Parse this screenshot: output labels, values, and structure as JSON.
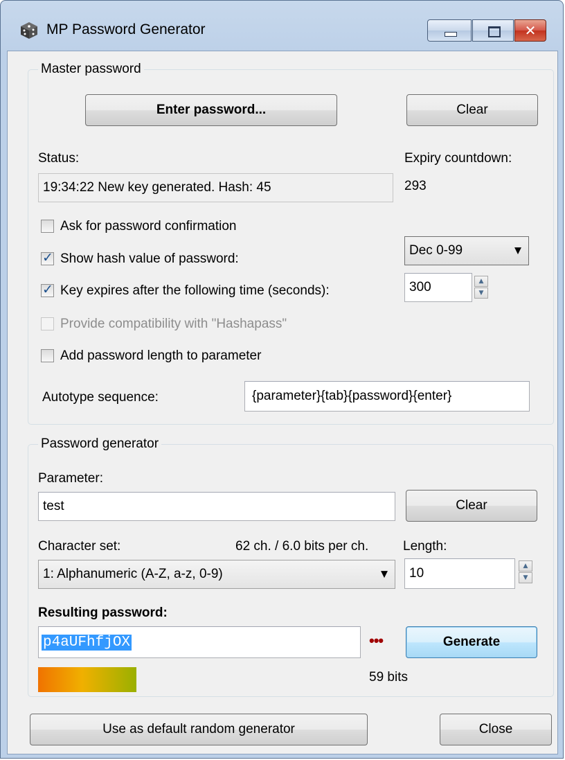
{
  "window": {
    "title": "MP Password Generator",
    "icons": {
      "app": "dice-icon",
      "minimize": "minimize-icon",
      "maximize": "maximize-icon",
      "close": "close-icon"
    },
    "close_glyph": "✕"
  },
  "master": {
    "group_label": "Master password",
    "enter_button": "Enter password...",
    "clear_button": "Clear",
    "status_label": "Status:",
    "status_value": "19:34:22 New key generated. Hash: 45",
    "expiry_label": "Expiry countdown:",
    "expiry_value": "293",
    "ask_confirmation": {
      "label": "Ask for password confirmation",
      "checked": false
    },
    "show_hash": {
      "label": "Show hash value of password:",
      "checked": true
    },
    "hash_format": "Dec 0-99",
    "key_expires": {
      "label": "Key expires after the following time (seconds):",
      "checked": true
    },
    "expiry_seconds": "300",
    "hashapass": {
      "label": "Provide compatibility with \"Hashapass\"",
      "checked": false,
      "enabled": false
    },
    "add_length": {
      "label": "Add password length to parameter",
      "checked": false
    },
    "autotype_label": "Autotype sequence:",
    "autotype_value": "{parameter}{tab}{password}{enter}"
  },
  "generator": {
    "group_label": "Password generator",
    "parameter_label": "Parameter:",
    "parameter_value": "test",
    "clear_button": "Clear",
    "charset_label": "Character set:",
    "charset_info": "62 ch. / 6.0 bits per ch.",
    "length_label": "Length:",
    "charset_value": "1: Alphanumeric (A-Z, a-z, 0-9)",
    "length_value": "10",
    "result_label": "Resulting password:",
    "result_value": "p4aUFhfjOX",
    "reveal_dots": "•••",
    "generate_button": "Generate",
    "strength_text": "59 bits",
    "strength_fraction": 0.59
  },
  "footer": {
    "default_button": "Use as default random generator",
    "close_button": "Close"
  },
  "colors": {
    "accent": "#3399ff",
    "strength_start": "#f07300",
    "strength_mid": "#f0b000",
    "strength_end": "#9ab000",
    "dots": "#a00000"
  }
}
